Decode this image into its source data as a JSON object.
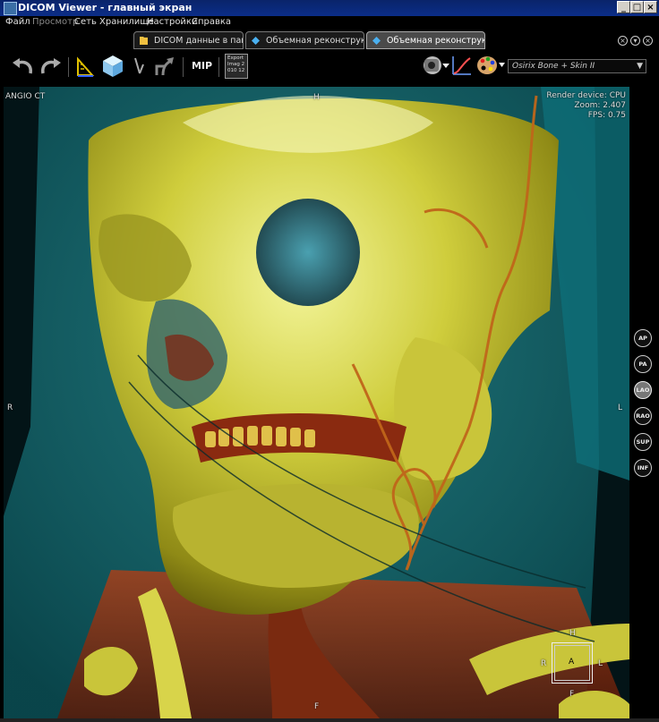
{
  "window": {
    "title": "DICOM Viewer - главный экран",
    "controls": [
      "_",
      "□",
      "×"
    ]
  },
  "menu": {
    "items": [
      {
        "label": "Файл",
        "enabled": true
      },
      {
        "label": "Просмотр",
        "enabled": false
      },
      {
        "label": "Сеть",
        "enabled": true
      },
      {
        "label": "Хранилище",
        "enabled": true
      },
      {
        "label": "Настройки",
        "enabled": true
      },
      {
        "label": "Справка",
        "enabled": true
      }
    ]
  },
  "tabs": [
    {
      "label": "DICOM данные в папке",
      "icon": "folder-icon",
      "active": false
    },
    {
      "label": "Объемная реконструкция",
      "icon": "volume-icon",
      "active": false
    },
    {
      "label": "Объемная реконструкция",
      "icon": "volume-icon",
      "active": true
    }
  ],
  "toolbar": {
    "mip_label": "MIP",
    "export_label": "Export Imag 2010 12",
    "preset_value": "Osirix Bone + Skin II",
    "icons": [
      "undo-icon",
      "redo-icon",
      "measure-icon",
      "cube-icon",
      "cursor-icon",
      "rotate-icon",
      "mip-button",
      "export-icon",
      "camera-icon",
      "curve-icon",
      "palette-icon"
    ]
  },
  "viewport": {
    "top_left": "ANGIO CT",
    "top_center": "H",
    "top_right_lines": [
      "Render device: CPU",
      "Zoom: 2.407",
      "FPS: 0.75"
    ],
    "left_mid": "R",
    "right_mid": "L",
    "bottom_center": "F",
    "orientation_cube": {
      "top": "H",
      "left": "R",
      "center": "A",
      "right": "L",
      "bottom": "F"
    }
  },
  "orientation_buttons": [
    {
      "label": "AP",
      "active": false
    },
    {
      "label": "PA",
      "active": false
    },
    {
      "label": "LAO",
      "active": true
    },
    {
      "label": "RAO",
      "active": false
    },
    {
      "label": "SUP",
      "active": false
    },
    {
      "label": "INF",
      "active": false
    }
  ],
  "colors": {
    "titlebar": "#0a246a",
    "bone": "#d8d84a",
    "skin": "#1e7a80",
    "vessel": "#b5561a"
  }
}
